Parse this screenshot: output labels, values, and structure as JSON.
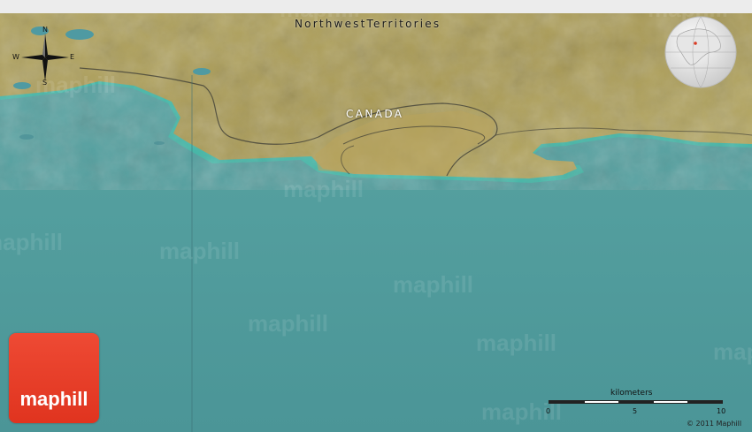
{
  "map": {
    "labels": {
      "territory": "NorthwestTerritories",
      "country": "CANADA"
    },
    "compass": {
      "north": "N",
      "south": "S",
      "east": "E",
      "west": "W"
    },
    "watermark_text": "maphill",
    "logo": {
      "text": "maphill",
      "color": "#e63b26"
    },
    "scale": {
      "unit_label": "kilometers",
      "ticks": [
        "0",
        "5",
        "10"
      ]
    },
    "copyright": "© 2011 Maphill",
    "colors": {
      "water": "#4d9a9d",
      "land": "#a89a55",
      "shore": "#3fb8a6"
    }
  }
}
